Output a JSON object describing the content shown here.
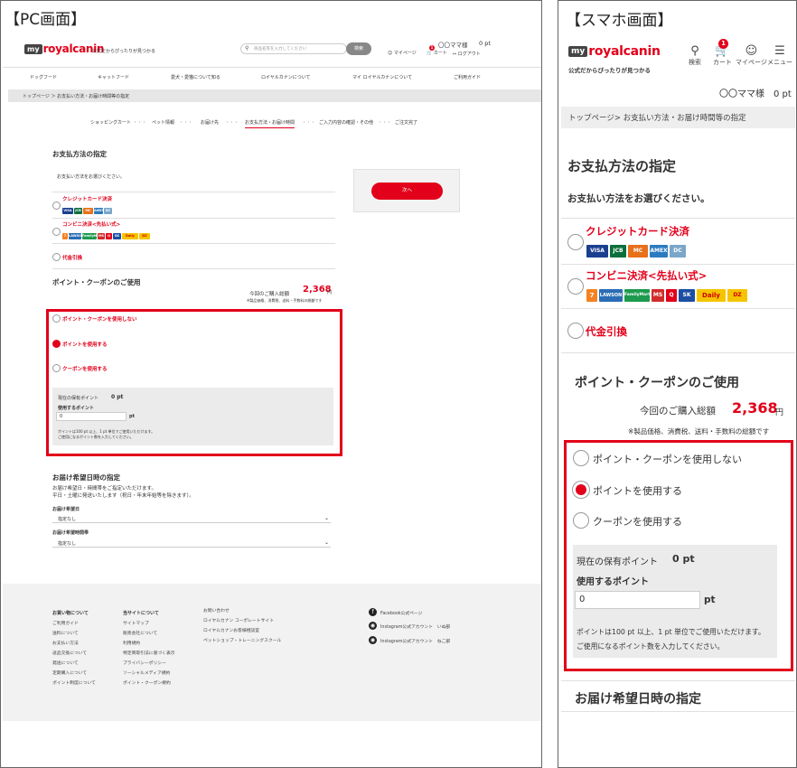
{
  "pc": {
    "panel_label": "【PC画面】",
    "logo_my": "my",
    "logo_brand": "royalcanin",
    "tagline": "公式だからぴったりが見つかる",
    "search_placeholder": "商品名等を入力してください",
    "search_button": "検索",
    "user_name": "〇〇ママ様",
    "points": "0 pt",
    "mypage": "マイページ",
    "cart": "カート",
    "cart_badge": "1",
    "logout": "ログアウト",
    "nav": [
      "ドッグフード",
      "キャットフード",
      "愛犬・愛猫について知る",
      "ロイヤルカナンについて",
      "マイ ロイヤルカナンについて",
      "ご利用ガイド"
    ],
    "breadcrumb": "トップページ ＞  お支払い方法・お届け時間等の指定",
    "steps": [
      "ショッピングカート",
      "ペット情報",
      "お届け先",
      "お支払方法・お届け時間",
      "ご入力内容の確認・その他",
      "ご注文完了"
    ],
    "step_sep": "・・・",
    "payment_title": "お支払方法の指定",
    "payment_prompt": "お支払い方法をお選びください。",
    "credit": "クレジットカード決済",
    "conbini": "コンビニ決済<先払い式>",
    "cod": "代金引換",
    "next_button": "次へ",
    "points_title": "ポイント・クーポンのご使用",
    "total_label": "今回のご購入総額",
    "total_value": "2,368",
    "total_unit": "円",
    "total_note": "※製品価格、消費税、送料・手数料の総額です",
    "opt_none": "ポイント・クーポンを使用しない",
    "opt_points": "ポイントを使用する",
    "opt_coupon": "クーポンを使用する",
    "held_label": "現在の保有ポイント",
    "held_value": "0 pt",
    "use_label": "使用するポイント",
    "use_value": "0",
    "use_unit": "pt",
    "note1": "ポイントは100 pt 以上、1 pt 単位でご使用いただけます。",
    "note2": "ご使用になるポイント数を入力してください。",
    "delivery_title": "お届け希望日時の指定",
    "delivery_t1": "お届け希望日・時間帯をご指定いただけます。",
    "delivery_t2": "平日・土曜に発送いたします（祝日・年末年始等を除きます）。",
    "date_label": "お届け希望日",
    "date_value": "指定なし",
    "time_label": "お届け希望時間帯",
    "time_value": "指定なし",
    "footer": {
      "col1_title": "お買い物について",
      "col1": [
        "ご利用ガイド",
        "送料について",
        "お支払い方法",
        "返品交換について",
        "発送について",
        "定期購入について",
        "ポイント制度について"
      ],
      "col2_title": "当サイトについて",
      "col2": [
        "サイトマップ",
        "販売会社について",
        "利用規約",
        "特定商取引法に基づく表示",
        "プライバシーポリシー",
        "ソーシャルメディア規約",
        "ポイント・クーポン規約"
      ],
      "col3": [
        "お問い合わせ",
        "ロイヤルカナン コーポレートサイト",
        "ロイヤルカナンお客様相談室",
        "ペットショップ・トレーニングスクール"
      ],
      "sns": [
        "Facebook公式ページ",
        "Instagram公式アカウント　いぬ部",
        "Instagram公式アカウント　ねこ部"
      ]
    },
    "card_brands": [
      "VISA",
      "JCB",
      "MC",
      "AMEX",
      "DC"
    ],
    "store_brands": [
      "7",
      "LAWSON",
      "FamilyMart",
      "MS",
      "Q",
      "SK",
      "Daily",
      "DZ"
    ]
  },
  "sp": {
    "panel_label": "【スマホ画面】",
    "logo_my": "my",
    "logo_brand": "royalcanin",
    "tagline": "公式だからぴったりが見つかる",
    "icon_search": "検索",
    "icon_cart": "カート",
    "icon_mypage": "マイページ",
    "icon_menu": "メニュー",
    "cart_badge": "1",
    "user_line": "〇〇ママ様　0 pt",
    "breadcrumb": "トップページ> お支払い方法・お届け時間等の指定",
    "payment_title": "お支払方法の指定",
    "payment_prompt": "お支払い方法をお選びください。",
    "credit": "クレジットカード決済",
    "conbini": "コンビニ決済<先払い式>",
    "cod": "代金引換",
    "points_title": "ポイント・クーポンのご使用",
    "total_label": "今回のご購入総額",
    "total_value": "2,368",
    "total_unit": "円",
    "total_note": "※製品価格、消費税、送料・手数料の総額です",
    "opt_none": "ポイント・クーポンを使用しない",
    "opt_points": "ポイントを使用する",
    "opt_coupon": "クーポンを使用する",
    "held_label": "現在の保有ポイント",
    "held_value": "0 pt",
    "use_label": "使用するポイント",
    "use_value": "0",
    "use_unit": "pt",
    "note1": "ポイントは100 pt 以上、1 pt 単位でご使用いただけます。",
    "note2": "ご使用になるポイント数を入力してください。",
    "delivery_title": "お届け希望日時の指定"
  },
  "colors": {
    "accent": "#e2001a",
    "gray_box": "#ebebeb",
    "footer_bg": "#f2f2f2"
  }
}
